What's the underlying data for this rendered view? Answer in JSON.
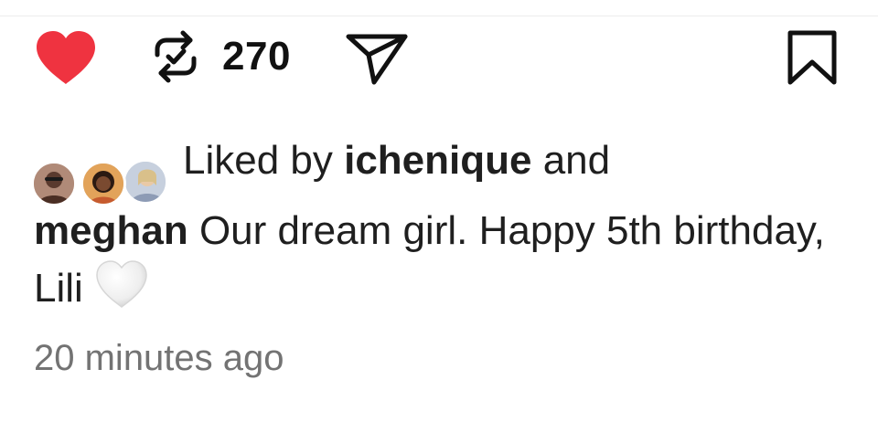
{
  "actions": {
    "repost_count": "270"
  },
  "likes": {
    "prefix": "Liked by ",
    "user": "ichenique",
    "suffix": " and"
  },
  "post": {
    "username": "meghan",
    "caption": "Our dream girl. Happy 5th birthday, Lili",
    "caption_emoji": "white-heart-emoji",
    "timestamp": "20 minutes ago"
  },
  "colors": {
    "like_red": "#ef3340",
    "text": "#1f1f1f",
    "muted": "#737373"
  }
}
